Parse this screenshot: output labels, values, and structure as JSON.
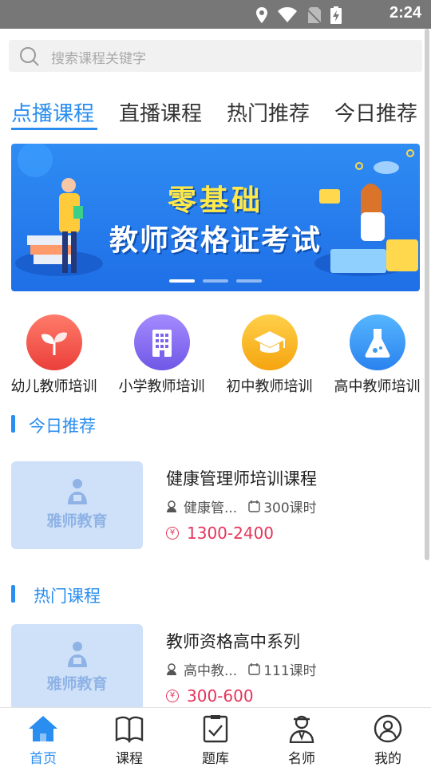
{
  "status_bar": {
    "time": "2:24"
  },
  "search": {
    "placeholder": "搜索课程关键字"
  },
  "tabs": [
    {
      "label": "点播课程",
      "active": true
    },
    {
      "label": "直播课程",
      "active": false
    },
    {
      "label": "热门推荐",
      "active": false
    },
    {
      "label": "今日推荐",
      "active": false
    }
  ],
  "banner": {
    "line1": "零基础",
    "line2": "教师资格证考试",
    "slides": 3,
    "current": 1
  },
  "categories": [
    {
      "label": "幼儿教师培训",
      "icon": "sprout-icon",
      "color": "#f0564a"
    },
    {
      "label": "小学教师培训",
      "icon": "building-icon",
      "color": "#8a6cf0"
    },
    {
      "label": "初中教师培训",
      "icon": "graduation-cap-icon",
      "color": "#f7b61e"
    },
    {
      "label": "高中教师培训",
      "icon": "flask-icon",
      "color": "#3d9bf0"
    }
  ],
  "sections": {
    "today": {
      "title": "今日推荐",
      "courses": [
        {
          "brand": "雅师教育",
          "name": "健康管理师培训课程",
          "category": "健康管...",
          "lessons": "300课时",
          "price": "1300-2400"
        }
      ]
    },
    "hot": {
      "title": "热门课程",
      "courses": [
        {
          "brand": "雅师教育",
          "name": "教师资格高中系列",
          "category": "高中教...",
          "lessons": "111课时",
          "price": "300-600"
        }
      ]
    }
  },
  "price_symbol": "¥",
  "nav": [
    {
      "label": "首页",
      "icon": "home-icon",
      "active": true
    },
    {
      "label": "课程",
      "icon": "book-icon",
      "active": false
    },
    {
      "label": "题库",
      "icon": "checklist-icon",
      "active": false
    },
    {
      "label": "名师",
      "icon": "teacher-icon",
      "active": false
    },
    {
      "label": "我的",
      "icon": "user-icon",
      "active": false
    }
  ],
  "colors": {
    "accent": "#2a8df0",
    "price": "#e6345a",
    "status_bar": "#777777"
  }
}
